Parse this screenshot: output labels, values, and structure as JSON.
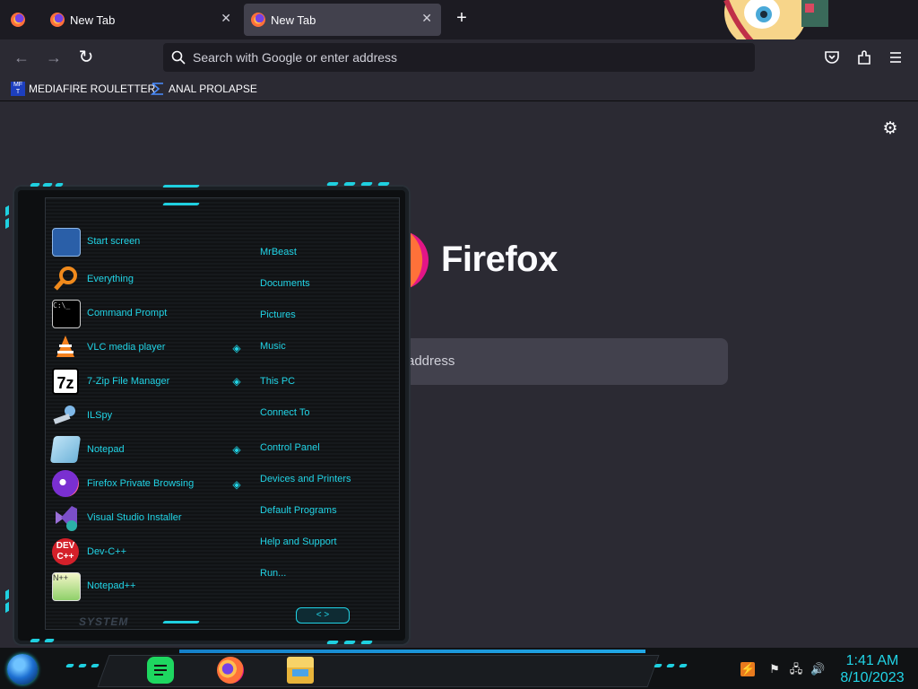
{
  "browser": {
    "tabs": [
      {
        "title": "New Tab",
        "close": "✕"
      },
      {
        "title": "New Tab",
        "close": "✕"
      }
    ],
    "new_tab_symbol": "+",
    "nav": {
      "back": "←",
      "forward": "→",
      "reload": "↻"
    },
    "urlbar_placeholder": "Search with Google or enter address",
    "toolbar_icons": [
      "pocket-icon",
      "extensions-icon",
      "menu-icon"
    ],
    "bookmarks": [
      {
        "label": "MEDIAFIRE ROULETTER",
        "icon": "mft-icon"
      },
      {
        "label": "ANAL PROLAPSE",
        "icon": "sigma-icon"
      }
    ],
    "newtab": {
      "brand": "Firefox",
      "search_placeholder_visible": "address"
    }
  },
  "start_menu": {
    "apps": [
      {
        "label": "Start screen",
        "icon": "start-screen-icon"
      },
      {
        "label": "Everything",
        "icon": "everything-icon"
      },
      {
        "label": "Command Prompt",
        "icon": "cmd-icon"
      },
      {
        "label": "VLC media player",
        "icon": "vlc-icon"
      },
      {
        "label": "7-Zip File Manager",
        "icon": "7zip-icon"
      },
      {
        "label": "ILSpy",
        "icon": "ilspy-icon"
      },
      {
        "label": "Notepad",
        "icon": "notepad-icon"
      },
      {
        "label": "Firefox Private Browsing",
        "icon": "firefox-private-icon"
      },
      {
        "label": "Visual Studio Installer",
        "icon": "vs-installer-icon"
      },
      {
        "label": "Dev-C++",
        "icon": "devcpp-icon"
      },
      {
        "label": "Notepad++",
        "icon": "notepadpp-icon"
      }
    ],
    "places": [
      "MrBeast",
      "Documents",
      "Pictures",
      "Music",
      "This PC",
      "Connect To",
      "Control Panel",
      "Devices and Printers",
      "Default Programs",
      "Help and Support",
      "Run..."
    ],
    "system_label": "SYSTEM",
    "arrows": "< >"
  },
  "taskbar": {
    "time": "1:41 AM",
    "date": "8/10/2023",
    "pinned": [
      "notes-app-icon",
      "firefox-icon",
      "file-explorer-icon"
    ],
    "tray": [
      "tray-app-icon",
      "flag-icon",
      "network-icon",
      "volume-icon"
    ]
  },
  "colors": {
    "accent_cyan": "#21d4e6",
    "bg": "#2b2a33",
    "urlbar": "#1c1b22"
  }
}
